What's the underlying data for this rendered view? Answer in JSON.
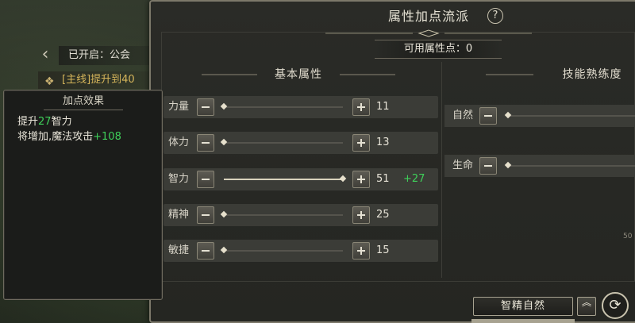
{
  "hud": {
    "opened_label": "已开启：公会",
    "quest_label": "[主线]提升到40"
  },
  "tooltip": {
    "title": "加点效果",
    "line1_prefix": "提升",
    "line1_amount": "27",
    "line1_suffix": "智力",
    "line2_prefix": "将增加,魔法攻击",
    "line2_amount": "+108"
  },
  "panel": {
    "title": "属性加点流派",
    "help_glyph": "?",
    "available_points": "可用属性点：0",
    "basic_attrs_title": "基本属性",
    "skills_title": "技能熟练度"
  },
  "attributes": [
    {
      "label": "力量",
      "value": "11",
      "bonus": "",
      "fill": 0.0
    },
    {
      "label": "体力",
      "value": "13",
      "bonus": "",
      "fill": 0.0
    },
    {
      "label": "智力",
      "value": "51",
      "bonus": "+27",
      "fill": 1.0
    },
    {
      "label": "精神",
      "value": "25",
      "bonus": "",
      "fill": 0.0
    },
    {
      "label": "敏捷",
      "value": "15",
      "bonus": "",
      "fill": 0.0
    }
  ],
  "skills": [
    {
      "label": "自然"
    },
    {
      "label": "生命"
    }
  ],
  "skill_value_fragment": "50",
  "controls": {
    "preset_label": "智精自然",
    "collapse_glyph": "︽",
    "reset_glyph": "⟳"
  }
}
